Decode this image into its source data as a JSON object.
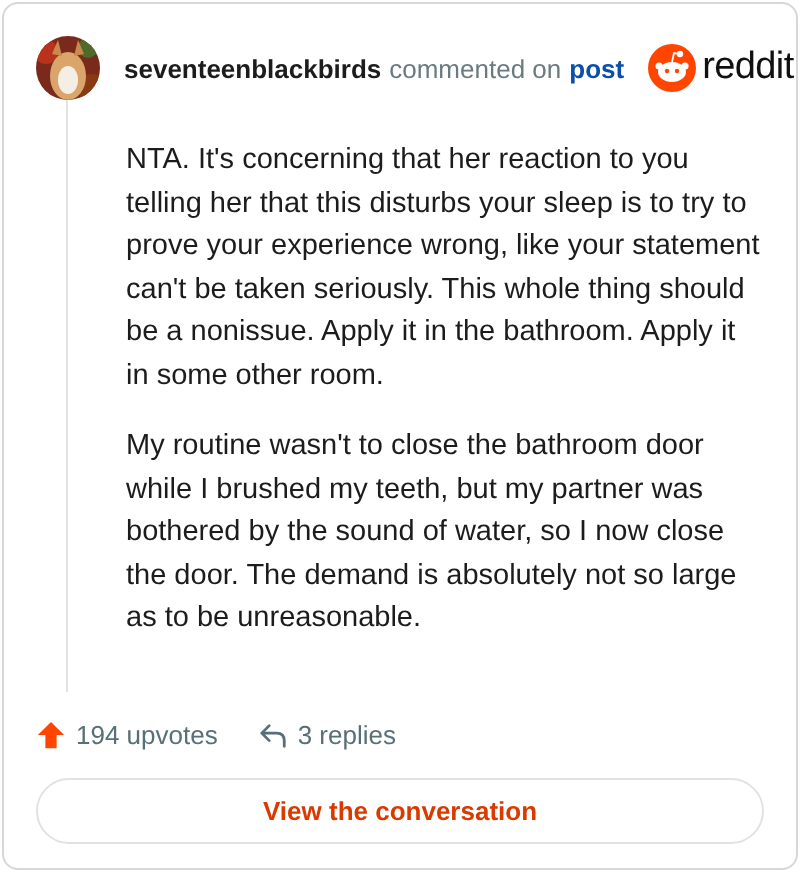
{
  "comment": {
    "author": "seventeenblackbirds",
    "action": "commented on",
    "link": "post",
    "logo_text": "reddit",
    "paragraphs": [
      "NTA. It's concerning that her reaction to you telling her that this disturbs your sleep is to try to prove your experience wrong, like your statement can't be taken seriously. This whole thing should be a nonissue. Apply it in the bathroom. Apply it in some other room.",
      "My routine wasn't to close the bathroom door while I brushed my teeth, but my partner was bothered by the sound of water, so I now close the door. The demand is absolutely not so large as to be unreasonable."
    ],
    "upvotes": "194 upvotes",
    "replies": "3 replies"
  },
  "button": "View the conversation"
}
